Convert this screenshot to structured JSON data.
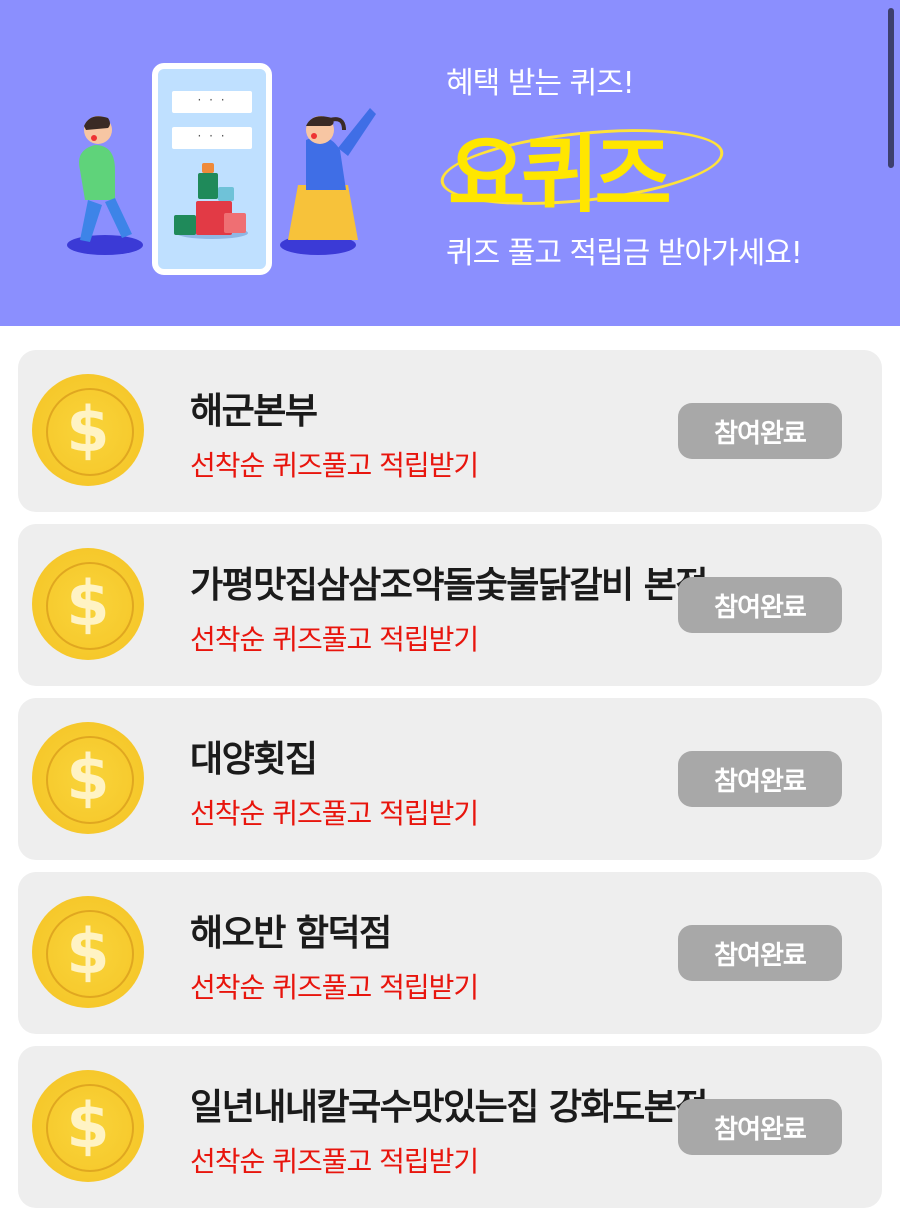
{
  "banner": {
    "subtitle": "혜택 받는 퀴즈!",
    "logo": "요퀴즈",
    "description": "퀴즈 풀고 적립금 받아가세요!",
    "bubble_text": "· · ·",
    "background_color": "#8b8ffe",
    "logo_color": "#ffe600"
  },
  "coin_symbol": "$",
  "quizzes": [
    {
      "title": "해군본부",
      "subtitle": "선착순 퀴즈풀고 적립받기",
      "button_label": "참여완료"
    },
    {
      "title": "가평맛집삼삼조약돌숯불닭갈비 본점",
      "subtitle": "선착순 퀴즈풀고 적립받기",
      "button_label": "참여완료"
    },
    {
      "title": "대양횟집",
      "subtitle": "선착순 퀴즈풀고 적립받기",
      "button_label": "참여완료"
    },
    {
      "title": "해오반 함덕점",
      "subtitle": "선착순 퀴즈풀고 적립받기",
      "button_label": "참여완료"
    },
    {
      "title": "일년내내칼국수맛있는집 강화도본점",
      "subtitle": "선착순 퀴즈풀고 적립받기",
      "button_label": "참여완료"
    }
  ],
  "colors": {
    "subtitle_red": "#e8150d",
    "button_gray": "#a8a8a8",
    "card_bg": "#eeeeee"
  }
}
